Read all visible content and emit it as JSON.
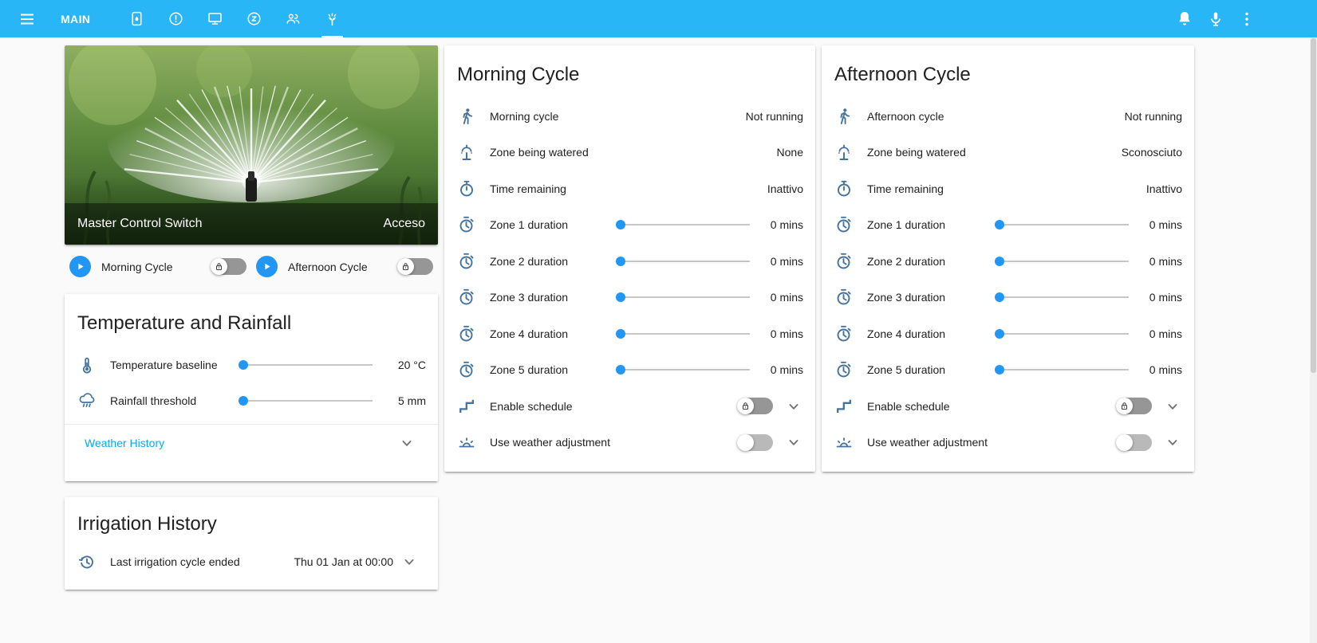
{
  "colors": {
    "header": "#29b6f6",
    "accent": "#2196f3",
    "icon": "#44739e",
    "link": "#03a9f4",
    "page_bg": "#fafafa",
    "text": "#212121"
  },
  "topbar": {
    "title": "MAIN",
    "tabs": [
      {
        "icon": "water-device-icon",
        "active": false
      },
      {
        "icon": "alert-circle-icon",
        "active": false
      },
      {
        "icon": "monitor-icon",
        "active": false
      },
      {
        "icon": "sleep-circle-icon",
        "active": false
      },
      {
        "icon": "people-icon",
        "active": false
      },
      {
        "icon": "irrigation-icon",
        "active": true
      }
    ]
  },
  "master_card": {
    "title": "Master Control Switch",
    "status": "Acceso",
    "cycle_buttons": [
      {
        "label": "Morning Cycle"
      },
      {
        "label": "Afternoon Cycle"
      }
    ]
  },
  "temperature_card": {
    "title": "Temperature and Rainfall",
    "rows": [
      {
        "icon": "thermometer-icon",
        "label": "Temperature baseline",
        "value": "20 °C",
        "slider_value": 0
      },
      {
        "icon": "weather-pouring-icon",
        "label": "Rainfall threshold",
        "value": "5 mm",
        "slider_value": 0
      }
    ],
    "link_label": "Weather History"
  },
  "irrigation_card": {
    "title": "Irrigation History",
    "row": {
      "icon": "history-icon",
      "label": "Last irrigation cycle ended",
      "value": "Thu 01 Jan at 00:00"
    }
  },
  "morning_card": {
    "title": "Morning Cycle",
    "rows": [
      {
        "icon": "walk-icon",
        "label": "Morning cycle",
        "value": "Not running"
      },
      {
        "icon": "fountain-icon",
        "label": "Zone being watered",
        "value": "None"
      },
      {
        "icon": "timer-icon",
        "label": "Time remaining",
        "value": "Inattivo"
      },
      {
        "icon": "stopwatch-icon",
        "label": "Zone 1 duration",
        "value": "0 mins",
        "slider_value": 0
      },
      {
        "icon": "stopwatch-icon",
        "label": "Zone 2 duration",
        "value": "0 mins",
        "slider_value": 0
      },
      {
        "icon": "stopwatch-icon",
        "label": "Zone 3 duration",
        "value": "0 mins",
        "slider_value": 0
      },
      {
        "icon": "stopwatch-icon",
        "label": "Zone 4 duration",
        "value": "0 mins",
        "slider_value": 0
      },
      {
        "icon": "stopwatch-icon",
        "label": "Zone 5 duration",
        "value": "0 mins",
        "slider_value": 0
      },
      {
        "icon": "valve-icon",
        "label": "Enable schedule",
        "control": "lock-toggle"
      },
      {
        "icon": "weather-sunset-icon",
        "label": "Use weather adjustment",
        "control": "toggle"
      }
    ]
  },
  "afternoon_card": {
    "title": "Afternoon Cycle",
    "rows": [
      {
        "icon": "walk-icon",
        "label": "Afternoon cycle",
        "value": "Not running"
      },
      {
        "icon": "fountain-icon",
        "label": "Zone being watered",
        "value": "Sconosciuto"
      },
      {
        "icon": "timer-icon",
        "label": "Time remaining",
        "value": "Inattivo"
      },
      {
        "icon": "stopwatch-icon",
        "label": "Zone 1 duration",
        "value": "0 mins",
        "slider_value": 0
      },
      {
        "icon": "stopwatch-icon",
        "label": "Zone 2 duration",
        "value": "0 mins",
        "slider_value": 0
      },
      {
        "icon": "stopwatch-icon",
        "label": "Zone 3 duration",
        "value": "0 mins",
        "slider_value": 0
      },
      {
        "icon": "stopwatch-icon",
        "label": "Zone 4 duration",
        "value": "0 mins",
        "slider_value": 0
      },
      {
        "icon": "stopwatch-icon",
        "label": "Zone 5 duration",
        "value": "0 mins",
        "slider_value": 0
      },
      {
        "icon": "valve-icon",
        "label": "Enable schedule",
        "control": "lock-toggle"
      },
      {
        "icon": "weather-sunset-icon",
        "label": "Use weather adjustment",
        "control": "toggle"
      }
    ]
  }
}
